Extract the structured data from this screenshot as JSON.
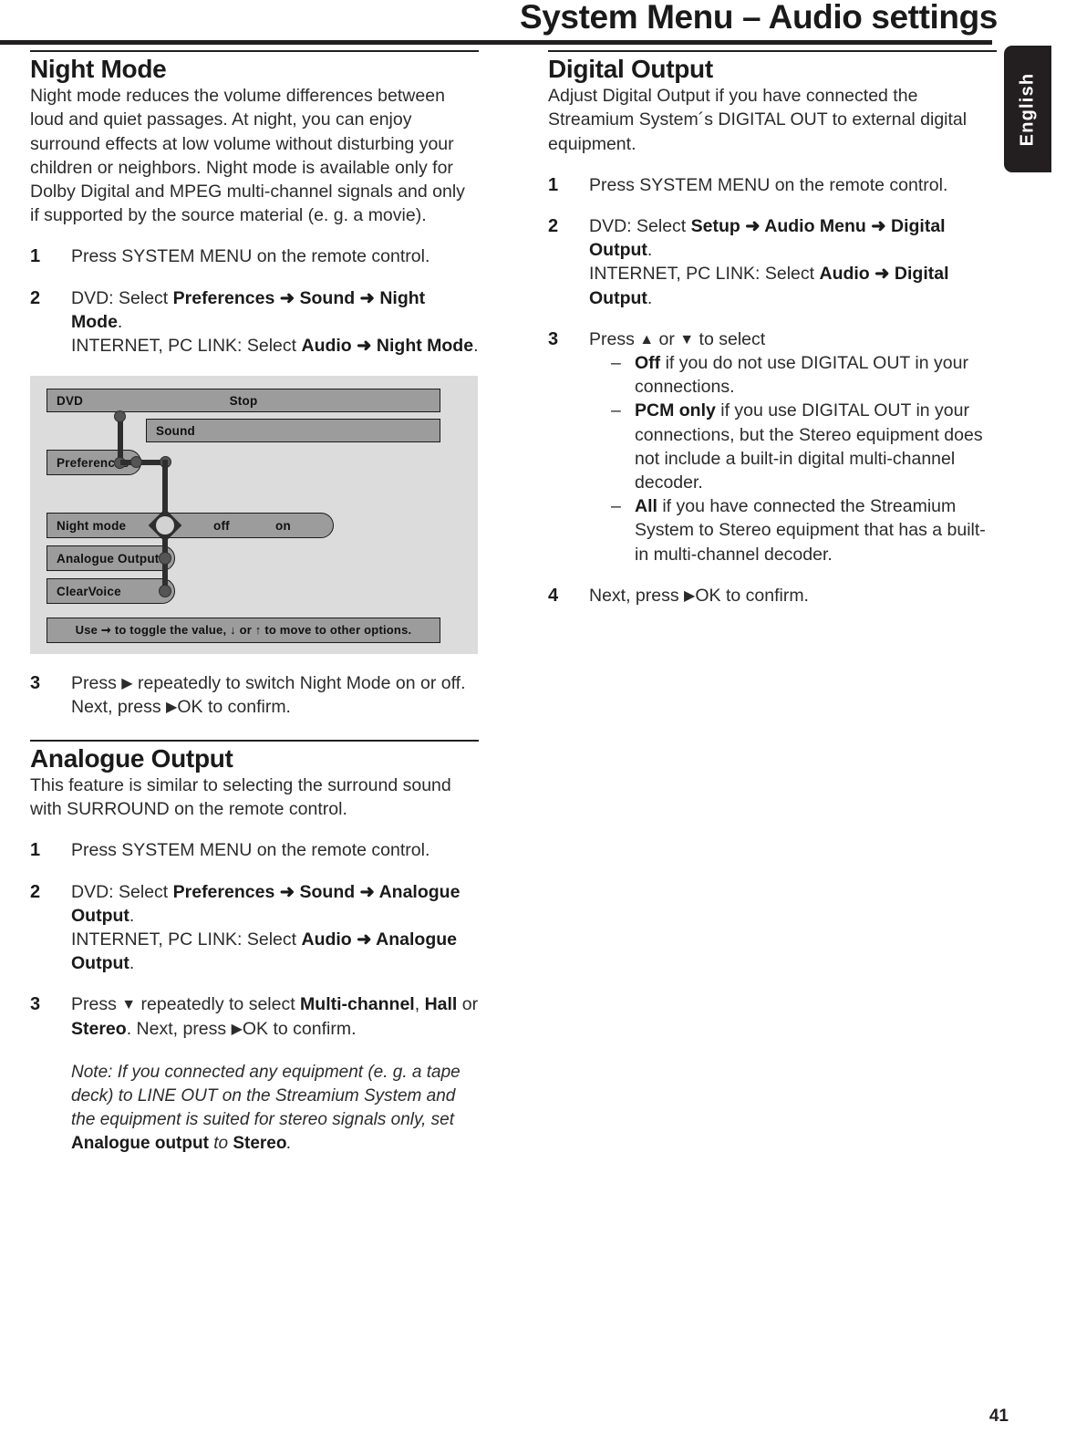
{
  "header": {
    "title": "System Menu – Audio settings",
    "language_tab": "English"
  },
  "page_number": "41",
  "left_column": {
    "night_mode": {
      "heading": "Night Mode",
      "intro": "Night mode reduces the volume differences between loud and quiet passages. At night, you can enjoy surround effects at low volume without disturbing your children or neighbors. Night mode is available only for Dolby Digital and MPEG multi-channel signals and only if supported by the source material (e. g. a movie).",
      "steps": [
        {
          "num": "1",
          "text": "Press SYSTEM MENU on the remote control."
        },
        {
          "num": "2",
          "line1_pre": "DVD: Select ",
          "line1_b1": "Preferences",
          "line1_a1": " ➜ ",
          "line1_b2": "Sound",
          "line1_a2": " ➜ ",
          "line1_b3": "Night Mode",
          "line1_post": ".",
          "line2_pre": "INTERNET, PC LINK: Select ",
          "line2_b1": "Audio",
          "line2_a1": " ➜ ",
          "line2_b2": "Night Mode",
          "line2_post": "."
        },
        {
          "num": "3",
          "text_pre": "Press ",
          "arrow": "▶",
          "text_mid": " repeatedly to switch Night Mode on or off. Next, press ",
          "arrow2": "▶",
          "text_post": "OK to confirm."
        }
      ]
    },
    "menu_screenshot": {
      "source_label": "DVD",
      "status_label": "Stop",
      "sound_label": "Sound",
      "preferences_label": "Preferences",
      "night_mode_label": "Night mode",
      "night_mode_off": "off",
      "night_mode_on": "on",
      "analogue_output_label": "Analogue Output",
      "clearvoice_label": "ClearVoice",
      "hint": "Use ➞ to toggle the value, ↓ or ↑ to move to other options."
    },
    "analogue_output": {
      "heading": "Analogue Output",
      "intro": "This feature is similar to selecting the surround sound with SURROUND on the remote control.",
      "steps": [
        {
          "num": "1",
          "text": "Press SYSTEM MENU on the remote control."
        },
        {
          "num": "2",
          "line1_pre": "DVD: Select ",
          "line1_b1": "Preferences",
          "line1_a1": " ➜ ",
          "line1_b2": "Sound",
          "line1_a2": " ➜ ",
          "line1_b3": "Analogue Output",
          "line1_post": ".",
          "line2_pre": "INTERNET, PC LINK: Select ",
          "line2_b1": "Audio",
          "line2_a1": " ➜ ",
          "line2_b2": "Analogue Output",
          "line2_post": "."
        },
        {
          "num": "3",
          "text_pre": "Press ",
          "arrow": "▼",
          "text_mid": " repeatedly to select ",
          "b1": "Multi-channel",
          "sep1": ", ",
          "b2": "Hall",
          "sep2": " or ",
          "b3": "Stereo",
          "text_mid2": ". Next, press ",
          "arrow2": "▶",
          "text_post": "OK to confirm."
        }
      ],
      "note_pre": "Note: ",
      "note_body1": "If you connected any equipment (e. g. a tape deck) to LINE OUT on the Streamium System and the equipment is suited for stereo signals only, set ",
      "note_b1": "Analogue output",
      "note_body2": " to ",
      "note_b2": "Stereo",
      "note_end": "."
    }
  },
  "right_column": {
    "digital_output": {
      "heading": "Digital Output",
      "intro": "Adjust Digital Output if you have connected the Streamium System´s DIGITAL OUT to external digital equipment.",
      "steps": [
        {
          "num": "1",
          "text": "Press SYSTEM MENU on the remote control."
        },
        {
          "num": "2",
          "line1_pre": "DVD: Select ",
          "line1_b1": "Setup",
          "line1_a1": " ➜ ",
          "line1_b2": "Audio Menu",
          "line1_a2": " ➜ ",
          "line1_b3": "Digital Output",
          "line1_post": ".",
          "line2_pre": "INTERNET, PC LINK: Select ",
          "line2_b1": "Audio",
          "line2_a1": " ➜ ",
          "line2_b2": "Digital Output",
          "line2_post": "."
        },
        {
          "num": "3",
          "text_pre": "Press ",
          "arrow_up": "▲",
          "text_mid": " or ",
          "arrow_down": "▼",
          "text_post": " to select"
        },
        {
          "num": "4",
          "text_pre": "Next, press ",
          "arrow": "▶",
          "text_post": "OK to confirm."
        }
      ],
      "options": [
        {
          "dash": "–",
          "bold": "Off",
          "text": " if you do not use DIGITAL OUT in your connections."
        },
        {
          "dash": "–",
          "bold": "PCM only",
          "text": " if you use DIGITAL OUT in your connections, but the Stereo equipment does not include a built-in digital multi-channel decoder."
        },
        {
          "dash": "–",
          "bold": "All",
          "text": " if you have connected the Streamium System to Stereo equipment that has a built-in multi-channel decoder."
        }
      ]
    }
  }
}
